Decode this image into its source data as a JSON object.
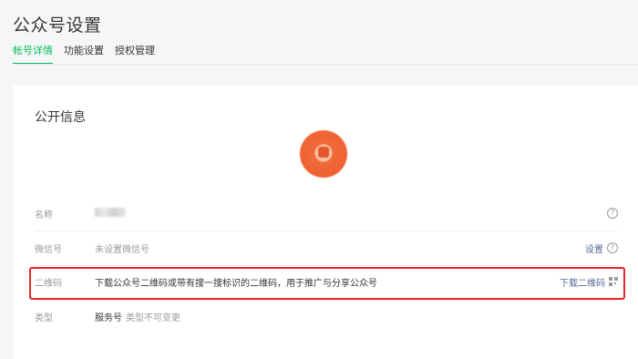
{
  "header": {
    "title": "公众号设置",
    "tabs": [
      {
        "label": "帐号详情",
        "active": true
      },
      {
        "label": "功能设置",
        "active": false
      },
      {
        "label": "授权管理",
        "active": false
      }
    ]
  },
  "card": {
    "section_title": "公开信息",
    "rows": {
      "name": {
        "label": "名称",
        "help": "?"
      },
      "wechat_id": {
        "label": "微信号",
        "value": "未设置微信号",
        "action": "设置",
        "help": "?"
      },
      "qrcode": {
        "label": "二维码",
        "value": "下载公众号二维码或带有搜一搜标识的二维码，用于推广与分享公众号",
        "action": "下载二维码"
      },
      "type": {
        "label": "类型",
        "value_main": "服务号",
        "value_note": "类型不可变更"
      }
    }
  },
  "colors": {
    "accent_green": "#07c160",
    "link_blue": "#576b95",
    "highlight_red": "#e5262b",
    "avatar_orange": "#ee5a2b"
  },
  "icons": {
    "help": "help-circle-icon",
    "qr": "qr-code-icon"
  }
}
